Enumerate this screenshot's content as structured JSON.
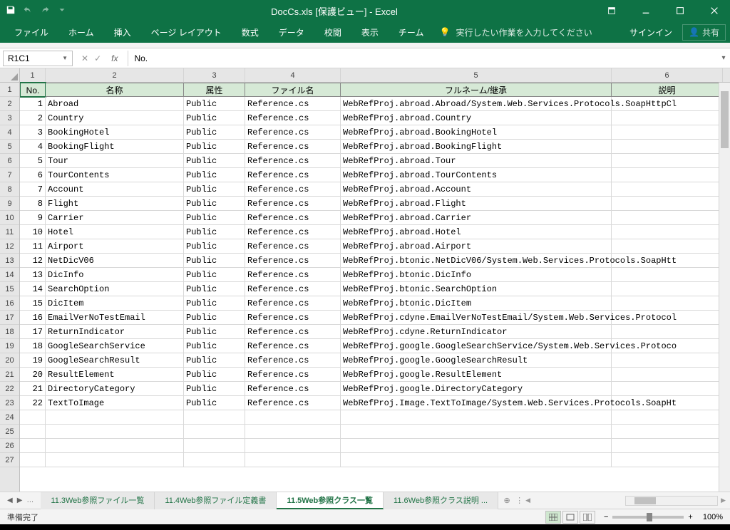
{
  "titlebar": {
    "doc_title": "DocCs.xls  [保護ビュー] - Excel"
  },
  "ribbon": {
    "tabs": [
      "ファイル",
      "ホーム",
      "挿入",
      "ページ レイアウト",
      "数式",
      "データ",
      "校閲",
      "表示",
      "チーム"
    ],
    "tell_me": "実行したい作業を入力してください",
    "signin": "サインイン",
    "share": "共有"
  },
  "formula": {
    "name_box": "R1C1",
    "fx": "fx",
    "content": "No."
  },
  "columns": [
    {
      "num": "1",
      "label": "No.",
      "cls": "c1"
    },
    {
      "num": "2",
      "label": "名称",
      "cls": "c2"
    },
    {
      "num": "3",
      "label": "属性",
      "cls": "c3"
    },
    {
      "num": "4",
      "label": "ファイル名",
      "cls": "c4"
    },
    {
      "num": "5",
      "label": "フルネーム/継承",
      "cls": "c5"
    },
    {
      "num": "6",
      "label": "説明",
      "cls": "c6"
    }
  ],
  "rows": [
    {
      "no": "1",
      "name": "Abroad",
      "attr": "Public",
      "file": "Reference.cs",
      "full": "WebRefProj.abroad.Abroad/System.Web.Services.Protocols.SoapHttpCl"
    },
    {
      "no": "2",
      "name": "Country",
      "attr": "Public",
      "file": "Reference.cs",
      "full": "WebRefProj.abroad.Country"
    },
    {
      "no": "3",
      "name": "BookingHotel",
      "attr": "Public",
      "file": "Reference.cs",
      "full": "WebRefProj.abroad.BookingHotel"
    },
    {
      "no": "4",
      "name": "BookingFlight",
      "attr": "Public",
      "file": "Reference.cs",
      "full": "WebRefProj.abroad.BookingFlight"
    },
    {
      "no": "5",
      "name": "Tour",
      "attr": "Public",
      "file": "Reference.cs",
      "full": "WebRefProj.abroad.Tour"
    },
    {
      "no": "6",
      "name": "TourContents",
      "attr": "Public",
      "file": "Reference.cs",
      "full": "WebRefProj.abroad.TourContents"
    },
    {
      "no": "7",
      "name": "Account",
      "attr": "Public",
      "file": "Reference.cs",
      "full": "WebRefProj.abroad.Account"
    },
    {
      "no": "8",
      "name": "Flight",
      "attr": "Public",
      "file": "Reference.cs",
      "full": "WebRefProj.abroad.Flight"
    },
    {
      "no": "9",
      "name": "Carrier",
      "attr": "Public",
      "file": "Reference.cs",
      "full": "WebRefProj.abroad.Carrier"
    },
    {
      "no": "10",
      "name": "Hotel",
      "attr": "Public",
      "file": "Reference.cs",
      "full": "WebRefProj.abroad.Hotel"
    },
    {
      "no": "11",
      "name": "Airport",
      "attr": "Public",
      "file": "Reference.cs",
      "full": "WebRefProj.abroad.Airport"
    },
    {
      "no": "12",
      "name": "NetDicV06",
      "attr": "Public",
      "file": "Reference.cs",
      "full": "WebRefProj.btonic.NetDicV06/System.Web.Services.Protocols.SoapHtt"
    },
    {
      "no": "13",
      "name": "DicInfo",
      "attr": "Public",
      "file": "Reference.cs",
      "full": "WebRefProj.btonic.DicInfo"
    },
    {
      "no": "14",
      "name": "SearchOption",
      "attr": "Public",
      "file": "Reference.cs",
      "full": "WebRefProj.btonic.SearchOption"
    },
    {
      "no": "15",
      "name": "DicItem",
      "attr": "Public",
      "file": "Reference.cs",
      "full": "WebRefProj.btonic.DicItem"
    },
    {
      "no": "16",
      "name": "EmailVerNoTestEmail",
      "attr": "Public",
      "file": "Reference.cs",
      "full": "WebRefProj.cdyne.EmailVerNoTestEmail/System.Web.Services.Protocol"
    },
    {
      "no": "17",
      "name": "ReturnIndicator",
      "attr": "Public",
      "file": "Reference.cs",
      "full": "WebRefProj.cdyne.ReturnIndicator"
    },
    {
      "no": "18",
      "name": "GoogleSearchService",
      "attr": "Public",
      "file": "Reference.cs",
      "full": "WebRefProj.google.GoogleSearchService/System.Web.Services.Protoco"
    },
    {
      "no": "19",
      "name": "GoogleSearchResult",
      "attr": "Public",
      "file": "Reference.cs",
      "full": "WebRefProj.google.GoogleSearchResult"
    },
    {
      "no": "20",
      "name": "ResultElement",
      "attr": "Public",
      "file": "Reference.cs",
      "full": "WebRefProj.google.ResultElement"
    },
    {
      "no": "21",
      "name": "DirectoryCategory",
      "attr": "Public",
      "file": "Reference.cs",
      "full": "WebRefProj.google.DirectoryCategory"
    },
    {
      "no": "22",
      "name": "TextToImage",
      "attr": "Public",
      "file": "Reference.cs",
      "full": "WebRefProj.Image.TextToImage/System.Web.Services.Protocols.SoapHt"
    }
  ],
  "empty_rows": [
    24,
    25,
    26,
    27
  ],
  "sheet_tabs": {
    "nav_more": "…",
    "tabs": [
      {
        "label": "11.3Web参照ファイル一覧",
        "active": false
      },
      {
        "label": "11.4Web参照ファイル定義書",
        "active": false
      },
      {
        "label": "11.5Web参照クラス一覧",
        "active": true
      },
      {
        "label": "11.6Web参照クラス説明 ...",
        "active": false
      }
    ],
    "add": "⊕"
  },
  "status": {
    "ready": "準備完了",
    "zoom": "100%"
  }
}
